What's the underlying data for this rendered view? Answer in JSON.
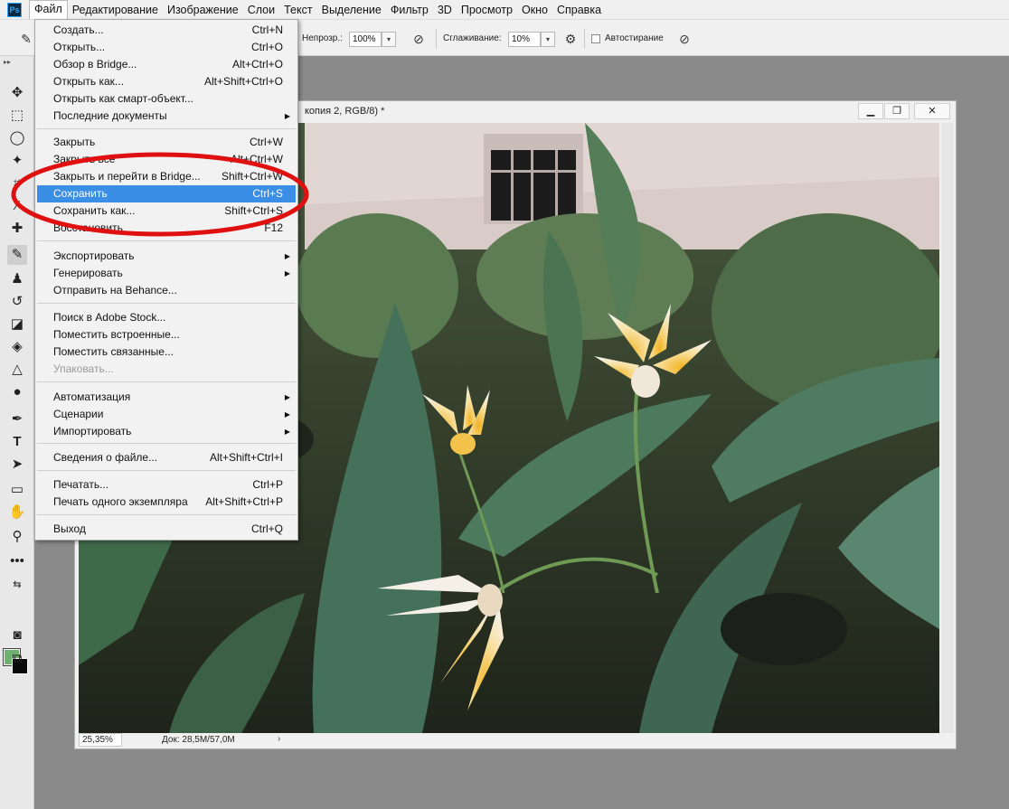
{
  "menubar": {
    "logo": "Ps",
    "items": [
      "Файл",
      "Редактирование",
      "Изображение",
      "Слои",
      "Текст",
      "Выделение",
      "Фильтр",
      "3D",
      "Просмотр",
      "Окно",
      "Справка"
    ]
  },
  "options": {
    "opacity_label": "Непрозр.:",
    "opacity_value": "100%",
    "smoothing_label": "Сглаживание:",
    "smoothing_value": "10%",
    "auto_erase_label": "Автостирание"
  },
  "document": {
    "title": "копия 2, RGB/8) *",
    "zoom": "25,35%",
    "doc_size": "Док: 28,5M/57,0M"
  },
  "file_menu": {
    "items": [
      {
        "label": "Создать...",
        "shortcut": "Ctrl+N"
      },
      {
        "label": "Открыть...",
        "shortcut": "Ctrl+O"
      },
      {
        "label": "Обзор в Bridge...",
        "shortcut": "Alt+Ctrl+O"
      },
      {
        "label": "Открыть как...",
        "shortcut": "Alt+Shift+Ctrl+O"
      },
      {
        "label": "Открыть как смарт-объект...",
        "shortcut": ""
      },
      {
        "label": "Последние документы",
        "shortcut": ""
      },
      {
        "label": "Закрыть",
        "shortcut": "Ctrl+W"
      },
      {
        "label": "Закрыть все",
        "shortcut": "Alt+Ctrl+W"
      },
      {
        "label": "Закрыть и перейти в Bridge...",
        "shortcut": "Shift+Ctrl+W"
      },
      {
        "label": "Сохранить",
        "shortcut": "Ctrl+S"
      },
      {
        "label": "Сохранить как...",
        "shortcut": "Shift+Ctrl+S"
      },
      {
        "label": "Восстановить",
        "shortcut": "F12"
      },
      {
        "label": "Экспортировать",
        "shortcut": ""
      },
      {
        "label": "Генерировать",
        "shortcut": ""
      },
      {
        "label": "Отправить на Behance...",
        "shortcut": ""
      },
      {
        "label": "Поиск в Adobe Stock...",
        "shortcut": ""
      },
      {
        "label": "Поместить встроенные...",
        "shortcut": ""
      },
      {
        "label": "Поместить связанные...",
        "shortcut": ""
      },
      {
        "label": "Упаковать...",
        "shortcut": ""
      },
      {
        "label": "Автоматизация",
        "shortcut": ""
      },
      {
        "label": "Сценарии",
        "shortcut": ""
      },
      {
        "label": "Импортировать",
        "shortcut": ""
      },
      {
        "label": "Сведения о файле...",
        "shortcut": "Alt+Shift+Ctrl+I"
      },
      {
        "label": "Печатать...",
        "shortcut": "Ctrl+P"
      },
      {
        "label": "Печать одного экземпляра",
        "shortcut": "Alt+Shift+Ctrl+P"
      },
      {
        "label": "Выход",
        "shortcut": "Ctrl+Q"
      }
    ]
  },
  "colors": {
    "highlight": "#3a8ee6",
    "annotation": "#e01010",
    "foreground_swatch": "#6fb26f",
    "background_swatch": "#0a0a0a"
  },
  "icons": {
    "toolbar": [
      "move-icon",
      "marquee-icon",
      "lasso-icon",
      "magic-wand-icon",
      "crop-icon",
      "eyedropper-icon",
      "healing-icon",
      "brush-icon",
      "stamp-icon",
      "history-brush-icon",
      "eraser-icon",
      "paint-bucket-icon",
      "blur-icon",
      "dodge-icon",
      "pen-icon",
      "type-icon",
      "path-select-icon",
      "rectangle-icon",
      "hand-icon",
      "zoom-icon",
      "more-tools-icon"
    ]
  }
}
